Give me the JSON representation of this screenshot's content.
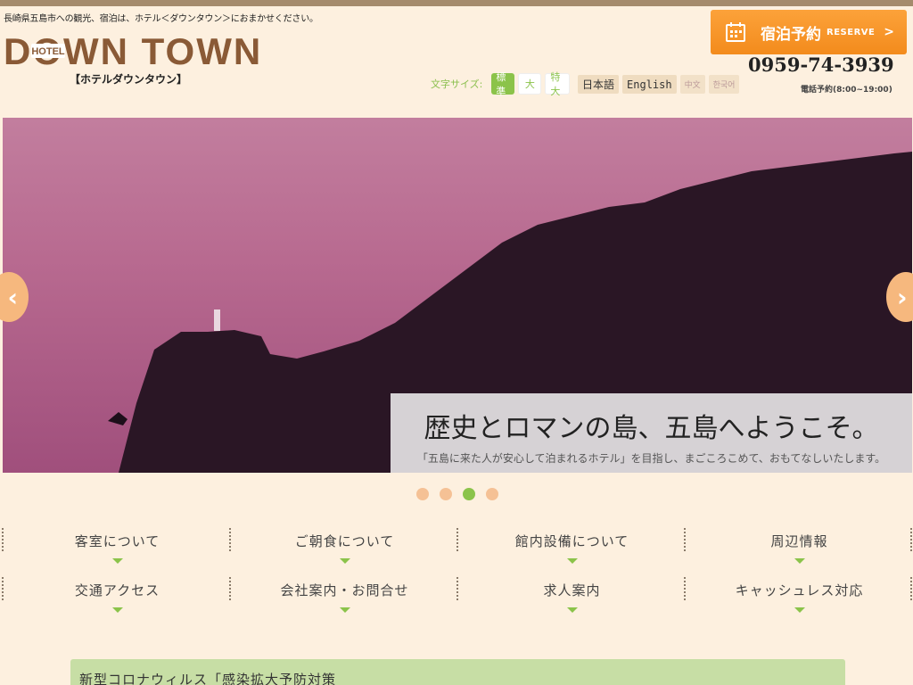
{
  "header": {
    "tagline": "長崎県五島市への観光、宿泊は、ホテル＜ダウンタウン＞におまかせください。",
    "logo_small": "HOTEL",
    "logo_main": "DOWN TOWN",
    "logo_sub": "【ホテルダウンタウン】",
    "font_size_label": "文字サイズ:",
    "font_sizes": [
      "標準",
      "大",
      "特大"
    ],
    "languages": [
      "日本語",
      "English",
      "中文",
      "한국어"
    ],
    "reserve": {
      "label": "宿泊予約",
      "label_en": "RESERVE",
      "arrow": ">"
    },
    "phone": "0959-74-3939",
    "phone_note": "電話予約(8:00~19:00)"
  },
  "hero": {
    "caption_title": "歴史とロマンの島、五島へようこそ。",
    "caption_text": "「五島に来た人が安心して泊まれるホテル」を目指し、まごころこめて、おもてなしいたします。",
    "prev": "‹",
    "next": "›",
    "slide_count": 4,
    "active_slide": 3
  },
  "menu": {
    "row1": [
      "客室について",
      "ご朝食について",
      "館内設備について",
      "周辺情報"
    ],
    "row2": [
      "交通アクセス",
      "会社案内・お問合せ",
      "求人案内",
      "キャッシュレス対応"
    ]
  },
  "notice": "新型コロナウィルス「感染拡大予防対策"
}
